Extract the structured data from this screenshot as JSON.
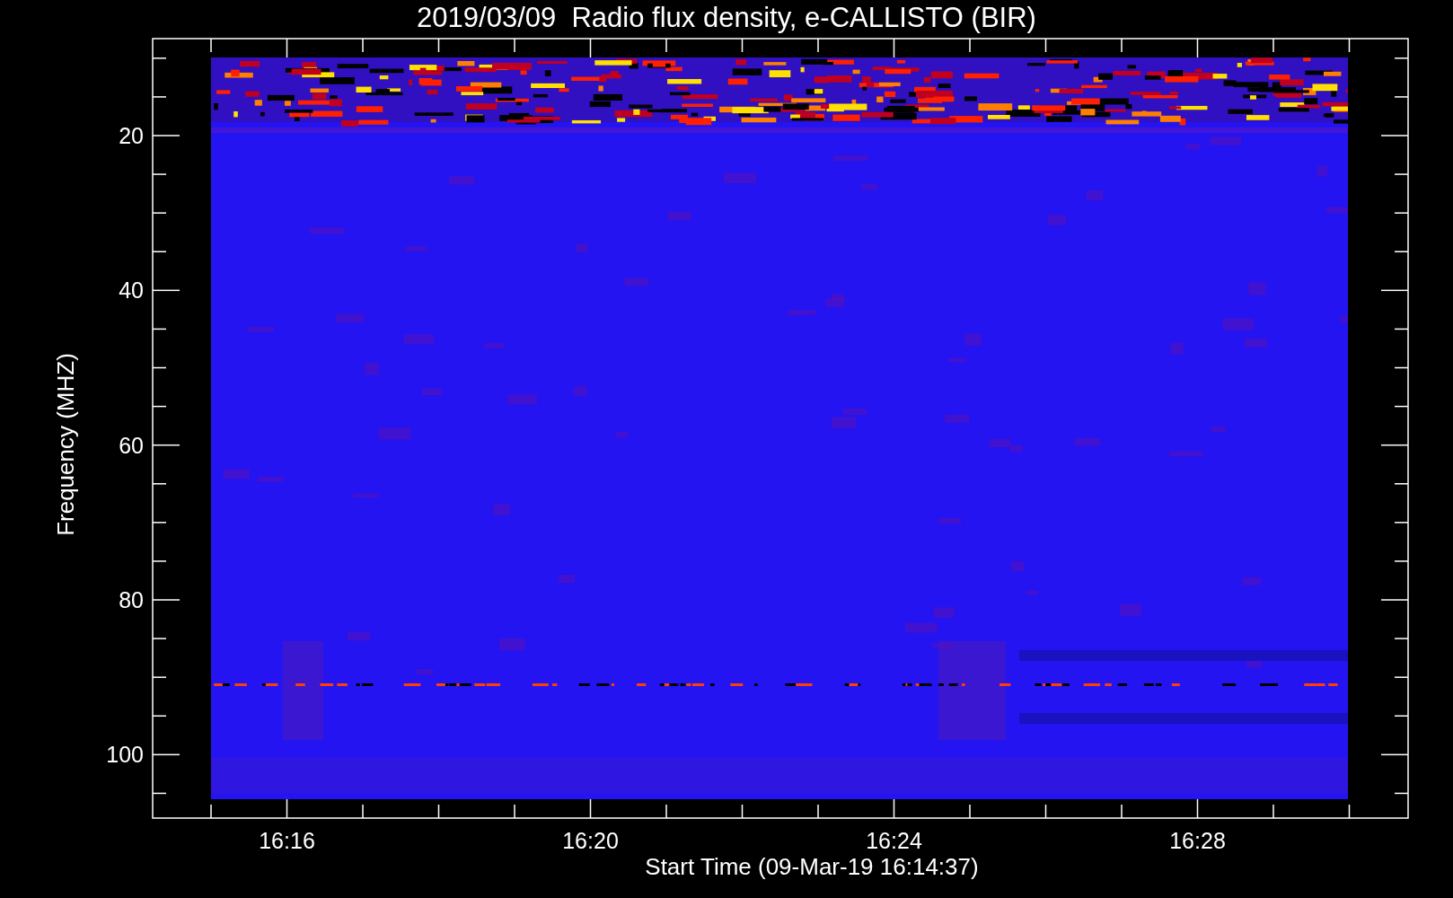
{
  "title": "2019/03/09  Radio flux density, e-CALLISTO (BIR)",
  "ylabel": "Frequency (MHZ)",
  "xlabel": "Start Time (09-Mar-19 16:14:37)",
  "yticks": [
    "20",
    "40",
    "60",
    "80",
    "100"
  ],
  "xticks": [
    "16:16",
    "16:20",
    "16:24",
    "16:28"
  ]
}
